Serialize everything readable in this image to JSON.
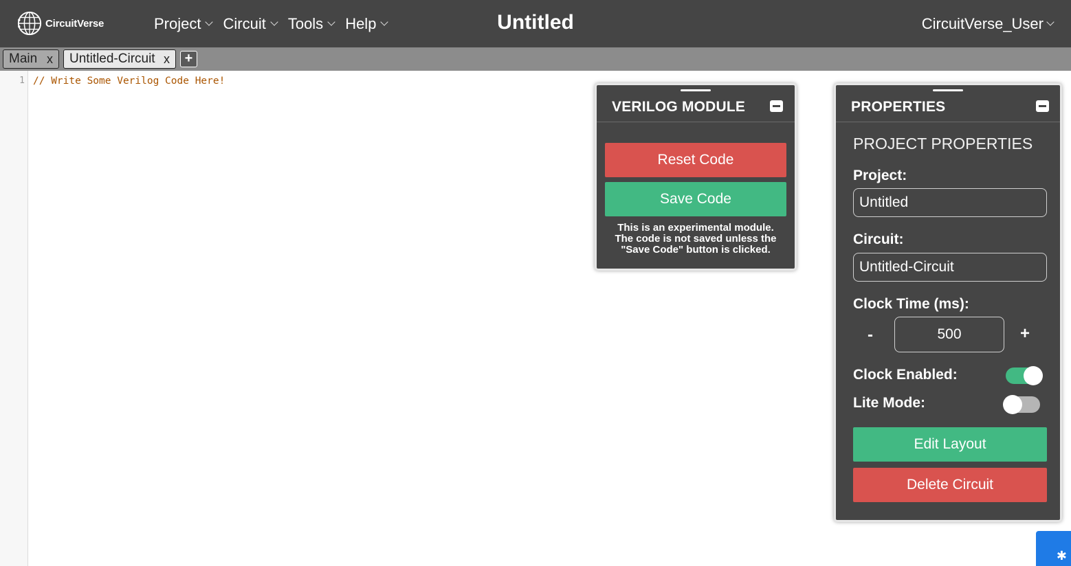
{
  "navbar": {
    "logo_text": "CircuitVerse",
    "menu": [
      {
        "label": "Project"
      },
      {
        "label": "Circuit"
      },
      {
        "label": "Tools"
      },
      {
        "label": "Help"
      }
    ],
    "project_title": "Untitled",
    "user": "CircuitVerse_User"
  },
  "tabs": {
    "items": [
      {
        "label": "Main",
        "close": "x"
      },
      {
        "label": "Untitled-Circuit",
        "close": "x"
      }
    ],
    "add_label": "+"
  },
  "editor": {
    "line_number": "1",
    "code": "// Write Some Verilog Code Here!"
  },
  "verilog_panel": {
    "title": "VERILOG MODULE",
    "reset_label": "Reset Code",
    "save_label": "Save Code",
    "note_line1": "This is an experimental module.",
    "note_line2": "The code is not saved unless the",
    "note_line3": "\"Save Code\" button is clicked."
  },
  "properties_panel": {
    "title": "PROPERTIES",
    "subtitle": "PROJECT PROPERTIES",
    "project_label": "Project:",
    "project_value": "Untitled",
    "circuit_label": "Circuit:",
    "circuit_value": "Untitled-Circuit",
    "clock_label": "Clock Time (ms):",
    "clock_minus": "-",
    "clock_value": "500",
    "clock_plus": "+",
    "clock_enabled_label": "Clock Enabled:",
    "clock_enabled": true,
    "lite_mode_label": "Lite Mode:",
    "lite_mode": false,
    "edit_layout_label": "Edit Layout",
    "delete_circuit_label": "Delete Circuit"
  },
  "colors": {
    "navbar": "#454545",
    "tabsbar": "#8c8c8c",
    "green": "#42b983",
    "red": "#d9534f",
    "code": "#aa5500",
    "corner_button": "#1f7be6"
  },
  "icons": {
    "logo": "circuitverse-globe-icon",
    "corner": "bug-icon"
  }
}
